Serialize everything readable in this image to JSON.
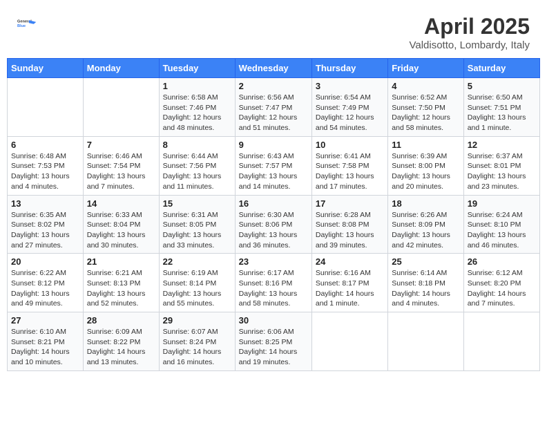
{
  "header": {
    "logo_general": "General",
    "logo_blue": "Blue",
    "title": "April 2025",
    "subtitle": "Valdisotto, Lombardy, Italy"
  },
  "days_of_week": [
    "Sunday",
    "Monday",
    "Tuesday",
    "Wednesday",
    "Thursday",
    "Friday",
    "Saturday"
  ],
  "weeks": [
    [
      {
        "day": null,
        "info": null
      },
      {
        "day": null,
        "info": null
      },
      {
        "day": "1",
        "info": "Sunrise: 6:58 AM\nSunset: 7:46 PM\nDaylight: 12 hours\nand 48 minutes."
      },
      {
        "day": "2",
        "info": "Sunrise: 6:56 AM\nSunset: 7:47 PM\nDaylight: 12 hours\nand 51 minutes."
      },
      {
        "day": "3",
        "info": "Sunrise: 6:54 AM\nSunset: 7:49 PM\nDaylight: 12 hours\nand 54 minutes."
      },
      {
        "day": "4",
        "info": "Sunrise: 6:52 AM\nSunset: 7:50 PM\nDaylight: 12 hours\nand 58 minutes."
      },
      {
        "day": "5",
        "info": "Sunrise: 6:50 AM\nSunset: 7:51 PM\nDaylight: 13 hours\nand 1 minute."
      }
    ],
    [
      {
        "day": "6",
        "info": "Sunrise: 6:48 AM\nSunset: 7:53 PM\nDaylight: 13 hours\nand 4 minutes."
      },
      {
        "day": "7",
        "info": "Sunrise: 6:46 AM\nSunset: 7:54 PM\nDaylight: 13 hours\nand 7 minutes."
      },
      {
        "day": "8",
        "info": "Sunrise: 6:44 AM\nSunset: 7:56 PM\nDaylight: 13 hours\nand 11 minutes."
      },
      {
        "day": "9",
        "info": "Sunrise: 6:43 AM\nSunset: 7:57 PM\nDaylight: 13 hours\nand 14 minutes."
      },
      {
        "day": "10",
        "info": "Sunrise: 6:41 AM\nSunset: 7:58 PM\nDaylight: 13 hours\nand 17 minutes."
      },
      {
        "day": "11",
        "info": "Sunrise: 6:39 AM\nSunset: 8:00 PM\nDaylight: 13 hours\nand 20 minutes."
      },
      {
        "day": "12",
        "info": "Sunrise: 6:37 AM\nSunset: 8:01 PM\nDaylight: 13 hours\nand 23 minutes."
      }
    ],
    [
      {
        "day": "13",
        "info": "Sunrise: 6:35 AM\nSunset: 8:02 PM\nDaylight: 13 hours\nand 27 minutes."
      },
      {
        "day": "14",
        "info": "Sunrise: 6:33 AM\nSunset: 8:04 PM\nDaylight: 13 hours\nand 30 minutes."
      },
      {
        "day": "15",
        "info": "Sunrise: 6:31 AM\nSunset: 8:05 PM\nDaylight: 13 hours\nand 33 minutes."
      },
      {
        "day": "16",
        "info": "Sunrise: 6:30 AM\nSunset: 8:06 PM\nDaylight: 13 hours\nand 36 minutes."
      },
      {
        "day": "17",
        "info": "Sunrise: 6:28 AM\nSunset: 8:08 PM\nDaylight: 13 hours\nand 39 minutes."
      },
      {
        "day": "18",
        "info": "Sunrise: 6:26 AM\nSunset: 8:09 PM\nDaylight: 13 hours\nand 42 minutes."
      },
      {
        "day": "19",
        "info": "Sunrise: 6:24 AM\nSunset: 8:10 PM\nDaylight: 13 hours\nand 46 minutes."
      }
    ],
    [
      {
        "day": "20",
        "info": "Sunrise: 6:22 AM\nSunset: 8:12 PM\nDaylight: 13 hours\nand 49 minutes."
      },
      {
        "day": "21",
        "info": "Sunrise: 6:21 AM\nSunset: 8:13 PM\nDaylight: 13 hours\nand 52 minutes."
      },
      {
        "day": "22",
        "info": "Sunrise: 6:19 AM\nSunset: 8:14 PM\nDaylight: 13 hours\nand 55 minutes."
      },
      {
        "day": "23",
        "info": "Sunrise: 6:17 AM\nSunset: 8:16 PM\nDaylight: 13 hours\nand 58 minutes."
      },
      {
        "day": "24",
        "info": "Sunrise: 6:16 AM\nSunset: 8:17 PM\nDaylight: 14 hours\nand 1 minute."
      },
      {
        "day": "25",
        "info": "Sunrise: 6:14 AM\nSunset: 8:18 PM\nDaylight: 14 hours\nand 4 minutes."
      },
      {
        "day": "26",
        "info": "Sunrise: 6:12 AM\nSunset: 8:20 PM\nDaylight: 14 hours\nand 7 minutes."
      }
    ],
    [
      {
        "day": "27",
        "info": "Sunrise: 6:10 AM\nSunset: 8:21 PM\nDaylight: 14 hours\nand 10 minutes."
      },
      {
        "day": "28",
        "info": "Sunrise: 6:09 AM\nSunset: 8:22 PM\nDaylight: 14 hours\nand 13 minutes."
      },
      {
        "day": "29",
        "info": "Sunrise: 6:07 AM\nSunset: 8:24 PM\nDaylight: 14 hours\nand 16 minutes."
      },
      {
        "day": "30",
        "info": "Sunrise: 6:06 AM\nSunset: 8:25 PM\nDaylight: 14 hours\nand 19 minutes."
      },
      {
        "day": null,
        "info": null
      },
      {
        "day": null,
        "info": null
      },
      {
        "day": null,
        "info": null
      }
    ]
  ]
}
